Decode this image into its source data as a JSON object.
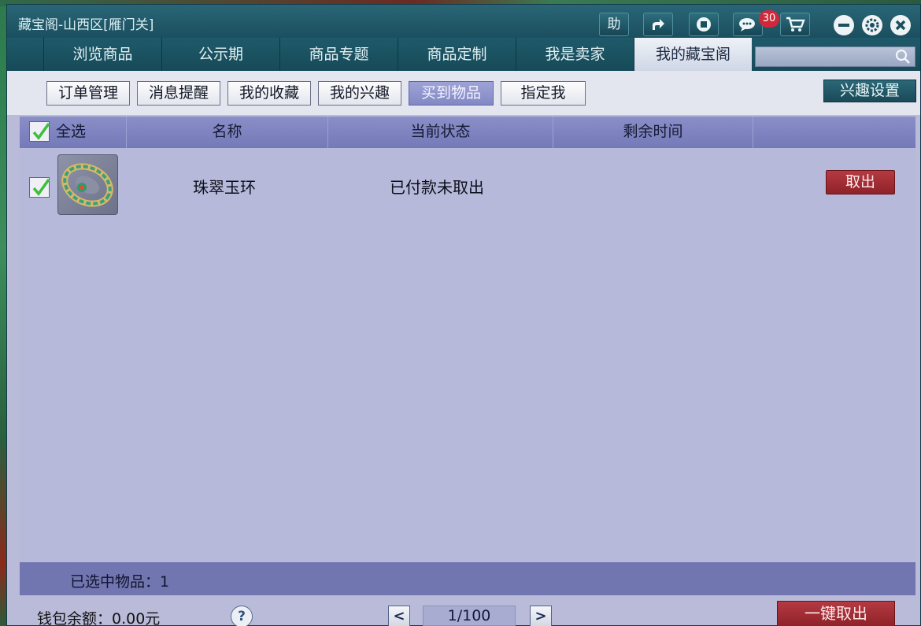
{
  "window": {
    "title": "藏宝阁-山西区[雁门关]"
  },
  "titlebar": {
    "help_label": "助",
    "message_count": "30",
    "icons": [
      "share-icon",
      "record-icon",
      "message-icon",
      "cart-icon",
      "minimize-icon",
      "settings-icon",
      "close-icon"
    ]
  },
  "nav": {
    "tabs": [
      {
        "label": "浏览商品"
      },
      {
        "label": "公示期"
      },
      {
        "label": "商品专题"
      },
      {
        "label": "商品定制"
      },
      {
        "label": "我是卖家"
      },
      {
        "label": "我的藏宝阁"
      }
    ],
    "active_tab": "我的藏宝阁",
    "search_value": ""
  },
  "subnav": {
    "buttons": [
      {
        "label": "订单管理"
      },
      {
        "label": "消息提醒"
      },
      {
        "label": "我的收藏"
      },
      {
        "label": "我的兴趣"
      },
      {
        "label": "买到物品"
      },
      {
        "label": "指定我"
      }
    ],
    "active": "买到物品",
    "interest_settings_label": "兴趣设置"
  },
  "table": {
    "select_all_label": "全选",
    "columns": [
      "名称",
      "当前状态",
      "剩余时间"
    ],
    "rows": [
      {
        "name": "珠翠玉环",
        "status": "已付款未取出",
        "remaining_time": "",
        "checked": true,
        "action_label": "取出"
      }
    ]
  },
  "summary": {
    "selected_label": "已选中物品：1"
  },
  "footer": {
    "wallet_label": "钱包余额：0.00元",
    "help_label": "?",
    "prev_label": "<",
    "next_label": ">",
    "page_display": "1/100",
    "take_all_label": "一键取出"
  },
  "colors": {
    "titlebar": "#1b4f5f",
    "panel": "#b7b9da",
    "header": "#7479b8",
    "action_red": "#a12e36"
  }
}
